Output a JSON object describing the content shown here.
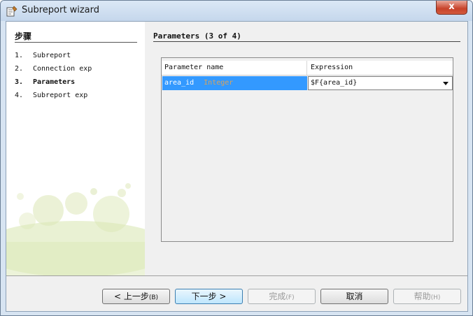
{
  "window": {
    "title": "Subreport wizard",
    "close_label": "x"
  },
  "steps": {
    "title": "步骤",
    "items": [
      {
        "num": "1.",
        "label": "Subreport"
      },
      {
        "num": "2.",
        "label": "Connection exp"
      },
      {
        "num": "3.",
        "label": "Parameters"
      },
      {
        "num": "4.",
        "label": "Subreport exp"
      }
    ],
    "current": 3
  },
  "content": {
    "title": "Parameters (3 of 4)",
    "table": {
      "columns": [
        "Parameter name",
        "Expression"
      ],
      "rows": [
        {
          "name": "area_id",
          "type": "Integer",
          "expression": "$F{area_id}"
        }
      ]
    }
  },
  "buttons": {
    "back": {
      "label": "< 上一步",
      "accel": "(B)"
    },
    "next": {
      "label": "下一步 >"
    },
    "finish": {
      "label": "完成",
      "accel": "(F)"
    },
    "cancel": {
      "label": "取消"
    },
    "help": {
      "label": "帮助",
      "accel": "(H)"
    }
  },
  "icons": {
    "app": "wizard-app-icon",
    "close": "close-icon",
    "dropdown": "chevron-down-icon"
  },
  "colors": {
    "selection": "#3399ff",
    "type_text": "#d7a35f",
    "close_red": "#c7422a"
  }
}
